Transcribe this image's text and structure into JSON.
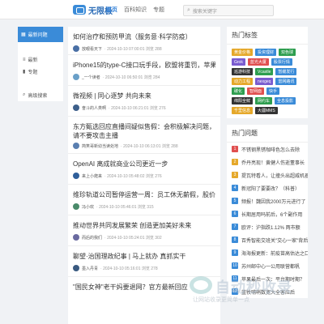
{
  "header": {
    "logo_text": "无限极",
    "nav": [
      "首页",
      "百科知识",
      "专题"
    ],
    "search_placeholder": "搜索关键字"
  },
  "sidebar": {
    "header": "最新问题",
    "items": [
      "最新",
      "专题"
    ],
    "footer": "高级搜索"
  },
  "feed": {
    "posts": [
      {
        "title": "如何治疗和预防甲流（服务意·科学防疫）",
        "author": "放眼看天下",
        "meta": "· 2024-10-10 07:00:01 浏览 288"
      },
      {
        "title": "iPhone15的type-C接口玩手段，欧盟将重罚，苹果会妥协么？",
        "author": "_一个读者",
        "meta": "· 2024-10-10 06:50:01 浏览 284"
      },
      {
        "title": "微视频 | 同心逐梦 共向未来",
        "author": "奋斗的人类啊",
        "meta": "· 2024-10-10 06:21:01 浏览 276"
      },
      {
        "title": "东方甄选回应直播间疑似售假：会积极解决问题，请不要攻击主播",
        "author": "简笑哥新幼当读处地",
        "meta": "· 2024-10-10 06:13:01 浏览 288"
      },
      {
        "title": "OpenAI 离成就商业公司更近一步",
        "author": "来上小爬来",
        "meta": "· 2024-10-10 05:48:02 浏览 276"
      },
      {
        "title": "维珍轨道公司暂停运营一周：员工休无薪假，股价暴跌50%",
        "author": "冯小欢",
        "meta": "· 2024-10-10 05:46:01 浏览 315"
      },
      {
        "title": "推动世界共同发展繁荣 创造更加美好未来",
        "author": "而后的我们",
        "meta": "· 2024-10-10 05:24:01 浏览 302"
      },
      {
        "title": "聊望·治国理政纪事 | 马上就办 真抓实干",
        "author": "墨入丹青",
        "meta": "· 2024-10-10 05:16:01 浏览 278"
      },
      {
        "title": "\"国民女神\"老干妈要退网？官方最新回应",
        "author": "",
        "meta": ""
      }
    ]
  },
  "hot_tags": {
    "title": "热门标签",
    "tags": [
      "黄金价格",
      "投资理财",
      "双色球",
      "Grok",
      "蓝光大厦",
      "股票行情",
      "巡游科技",
      "Vcastle",
      "暂缓发行",
      "动力工程",
      "nexgeq",
      "雷网路讯",
      "碳化",
      "智网面",
      "快手",
      "绵阳全鲜",
      "网约车",
      "全息投影",
      "千里信息",
      "大疆MMS"
    ],
    "colors": [
      "#e5a82a",
      "#3a8bd8",
      "#2e9e4f",
      "#7a5cd0",
      "#e04f4f",
      "#3a8bd8",
      "#333333",
      "#2e9e4f",
      "#3a8bd8",
      "#e5a82a",
      "#7a5cd0",
      "#3a8bd8",
      "#2e9e4f",
      "#e04f4f",
      "#3a8bd8",
      "#333333",
      "#2e9e4f",
      "#3a8bd8",
      "#e5a82a",
      "#333333"
    ]
  },
  "hot_questions": {
    "title": "热门问题",
    "items": [
      {
        "rank": "1",
        "text": "不锈钢黑锈咖啡色怎么去除"
      },
      {
        "rank": "2",
        "text": "乔丹亮现！黄健人伤逝董事长"
      },
      {
        "rank": "3",
        "text": "提瓦特看人，让撞头出超威机器"
      },
      {
        "rank": "4",
        "text": "新冠阳了要要改？（科普）"
      },
      {
        "rank": "5",
        "text": "频报！魏因我2000万元进行了"
      },
      {
        "rank": "6",
        "text": "长期居用吗前后，6个副作用"
      },
      {
        "rank": "7",
        "text": "欧评：沪指跌1.12% 两市额"
      },
      {
        "rank": "8",
        "text": "百秀智能交班关\"交心一家\"背后"
      },
      {
        "rank": "9",
        "text": "海海报更新：前疫苗高估达之口"
      },
      {
        "rank": "10",
        "text": "苏州邮中心一公用联营都帆"
      },
      {
        "rank": "11",
        "text": "苹果最后一次：平台期时期？"
      },
      {
        "rank": "12",
        "text": "蓝牧哺哨数宽大全客应后"
      }
    ],
    "rank_colors": [
      "#e04f4f",
      "#e5a82a",
      "#e5a82a",
      "#3a8bd8",
      "#3a8bd8",
      "#3a8bd8",
      "#3a8bd8",
      "#3a8bd8",
      "#3a8bd8",
      "#3a8bd8",
      "#3a8bd8",
      "#3a8bd8"
    ]
  },
  "watermark": {
    "text": "自动秒收录",
    "sub": "让网站收录更简单一点"
  }
}
